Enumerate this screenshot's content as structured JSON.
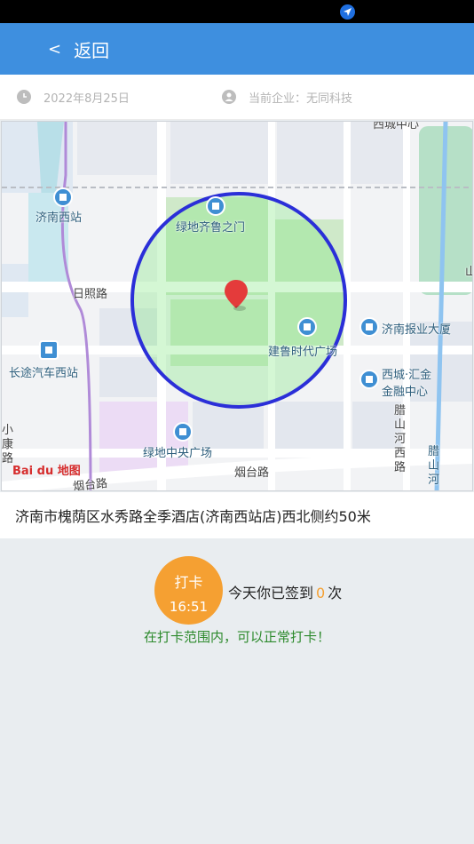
{
  "header": {
    "back_icon": "<",
    "back_label": "返回"
  },
  "info": {
    "date": "2022年8月25日",
    "date_icon": "clock-icon",
    "company": "当前企业：无同科技",
    "company_icon": "company-icon"
  },
  "map": {
    "labels": {
      "jinan_west": "济南西站",
      "lvdi_gate": "绿地齐鲁之门",
      "rizhao": "日照路",
      "bus_station": "长途汽车西站",
      "jianlu": "建鲁时代广场",
      "newspaper": "济南报业大厦",
      "xicheng": "西城·汇金",
      "finance": "金融中心",
      "lvdi_center": "绿地中央广场",
      "yantai1": "烟台路",
      "yantai2": "烟台路",
      "lashan_river": "腊山河西路",
      "lashan2": "腊山河",
      "xiaokang": "小康路",
      "top_cut": "西城中心",
      "right_cut": "山"
    },
    "baidu_logo": "Bai du 地图"
  },
  "address": "济南市槐荫区水秀路全季酒店(济南西站店)西北侧约50米",
  "punch": {
    "label": "打卡",
    "time": "16:51"
  },
  "count": {
    "prefix": "今天你已签到",
    "value": "0",
    "suffix": "次"
  },
  "range_message": "在打卡范围内，可以正常打卡！",
  "colors": {
    "accent": "#3e8fdf",
    "punch": "#f5a032",
    "ok": "#2d8a2d",
    "circle": "#2b2fd8"
  }
}
